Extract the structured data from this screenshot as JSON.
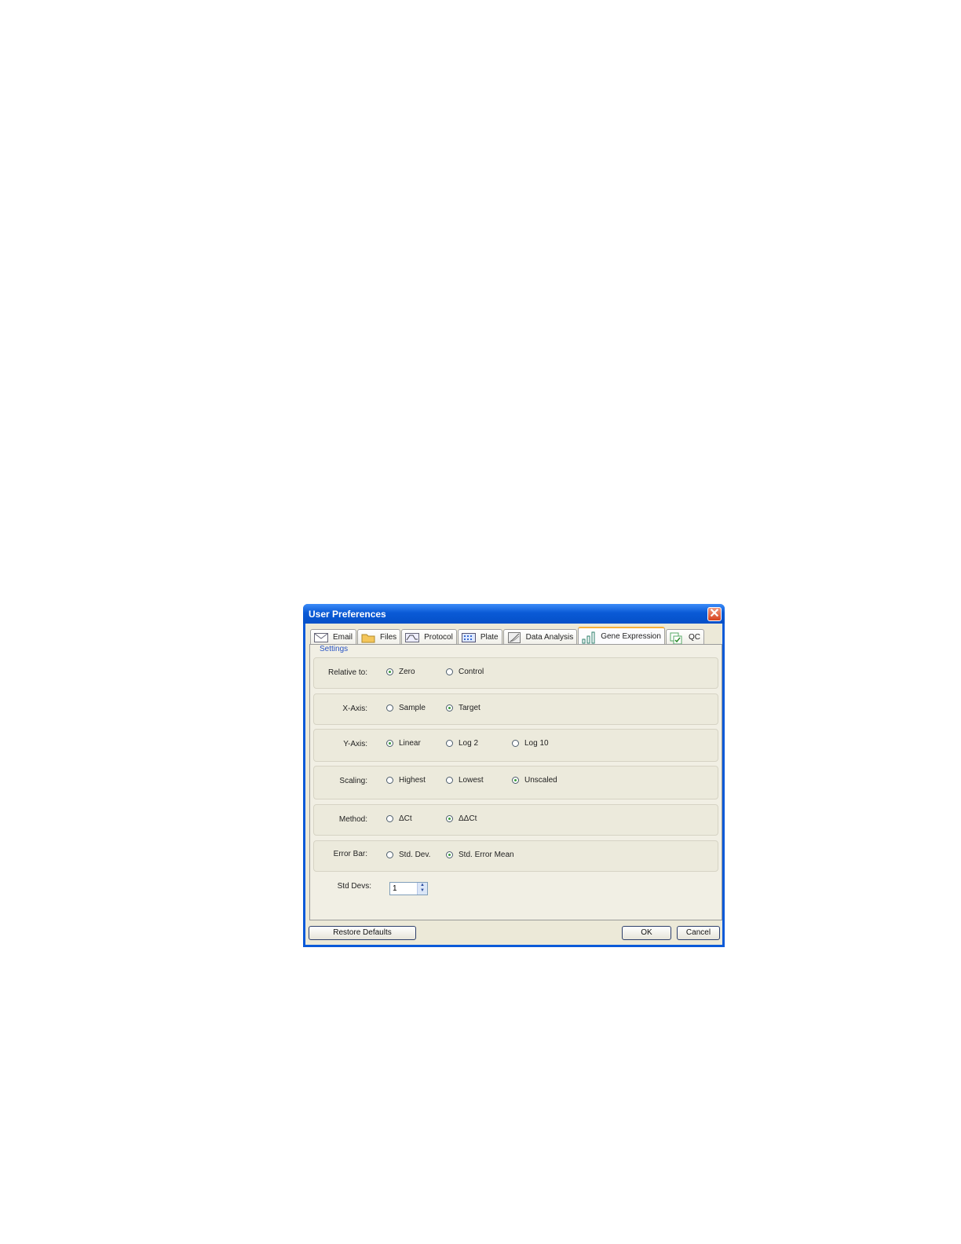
{
  "dialog": {
    "title": "User Preferences",
    "close_glyph": "✕"
  },
  "tabs": [
    {
      "label": "Email",
      "icon": "email-icon"
    },
    {
      "label": "Files",
      "icon": "folder-icon"
    },
    {
      "label": "Protocol",
      "icon": "protocol-icon"
    },
    {
      "label": "Plate",
      "icon": "plate-icon"
    },
    {
      "label": "Data Analysis",
      "icon": "data-analysis-icon"
    },
    {
      "label": "Gene Expression",
      "icon": "bar-chart-icon",
      "active": true
    },
    {
      "label": "QC",
      "icon": "qc-icon"
    }
  ],
  "settings": {
    "legend": "Settings",
    "relative_to": {
      "label": "Relative to:",
      "options": [
        "Zero",
        "Control"
      ],
      "selected": "Zero"
    },
    "x_axis": {
      "label": "X-Axis:",
      "options": [
        "Sample",
        "Target"
      ],
      "selected": "Target"
    },
    "y_axis": {
      "label": "Y-Axis:",
      "options": [
        "Linear",
        "Log 2",
        "Log 10"
      ],
      "selected": "Linear"
    },
    "scaling": {
      "label": "Scaling:",
      "options": [
        "Highest",
        "Lowest",
        "Unscaled"
      ],
      "selected": "Unscaled"
    },
    "method": {
      "label": "Method:",
      "options": [
        "ΔCt",
        "ΔΔCt"
      ],
      "selected": "ΔΔCt"
    },
    "error_bar": {
      "label": "Error Bar:",
      "options": [
        "Std. Dev.",
        "Std. Error Mean"
      ],
      "selected": "Std. Error Mean"
    },
    "std_devs": {
      "label": "Std Devs:",
      "value": "1"
    }
  },
  "buttons": {
    "restore": "Restore Defaults",
    "ok": "OK",
    "cancel": "Cancel"
  },
  "colors": {
    "title_bar": "#0a5ad6",
    "dialog_bg": "#ece9d8",
    "active_tab_accent": "#f7b13a",
    "radio_dot": "#3a9c3a",
    "legend_text": "#2a55c5"
  }
}
